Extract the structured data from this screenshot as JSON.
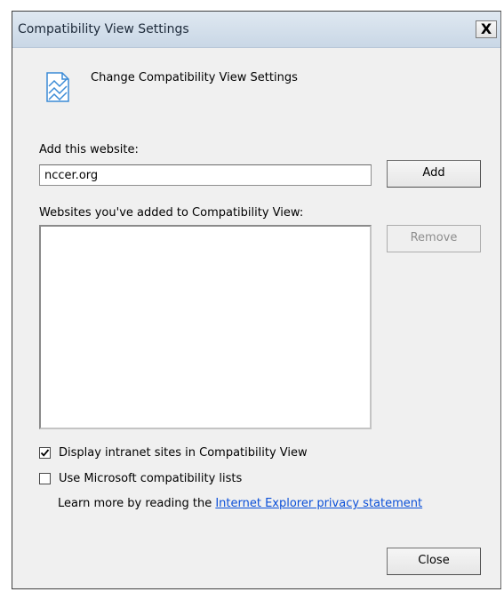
{
  "window": {
    "title": "Compatibility View Settings",
    "close_glyph": "X"
  },
  "header": {
    "icon": "compatibility-view-icon",
    "text": "Change Compatibility View Settings"
  },
  "add_section": {
    "label": "Add this website:",
    "input_value": "nccer.org",
    "add_button": "Add"
  },
  "list_section": {
    "label": "Websites you've added to Compatibility View:",
    "items": [],
    "remove_button": "Remove"
  },
  "options": {
    "intranet": {
      "label": "Display intranet sites in Compatibility View",
      "checked": true
    },
    "microsoft_lists": {
      "label": "Use Microsoft compatibility lists",
      "checked": false
    }
  },
  "privacy": {
    "prefix": "Learn more by reading the ",
    "link_text": "Internet Explorer privacy statement"
  },
  "footer": {
    "close_button": "Close"
  },
  "colors": {
    "link": "#0a4fd8",
    "titlebar": "#d4e0ec",
    "dialog_bg": "#f0f0f0"
  }
}
